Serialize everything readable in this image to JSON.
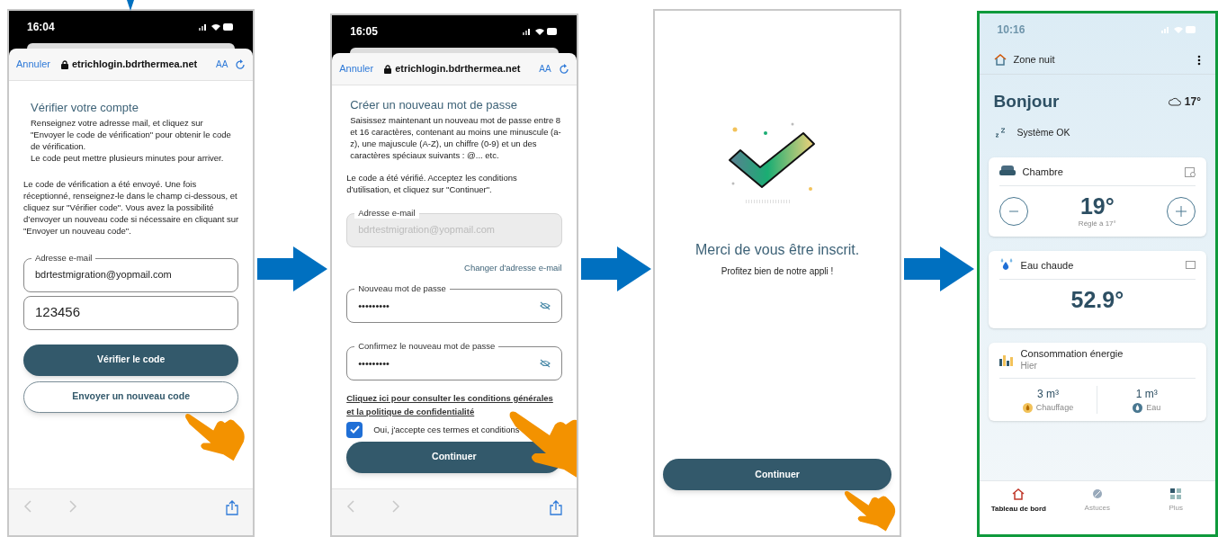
{
  "screens": [
    {
      "kind": "verify",
      "time": "16:04",
      "browser": {
        "cancel": "Annuler",
        "url": "etrichlogin.bdrthermea.net",
        "text_size": "AA"
      },
      "title": "Vérifier votre compte",
      "paragraphs": [
        "Renseignez votre adresse mail, et cliquez sur \"Envoyer le code de vérification\" pour obtenir le code de vérification.\nLe code peut mettre plusieurs minutes pour arriver.",
        "Le code de vérification a été envoyé. Une fois réceptionné, renseignez-le dans le champ ci-dessous, et cliquez sur \"Vérifier code\". Vous avez la possibilité d’envoyer un nouveau code si nécessaire en cliquant sur \"Envoyer un nouveau code\"."
      ],
      "email_field": {
        "label": "Adresse e-mail",
        "value": "bdrtestmigration@yopmail.com",
        "disabled": false
      },
      "code_field": {
        "value": "123456"
      },
      "buttons": [
        {
          "label": "Vérifier le code",
          "primary": true
        },
        {
          "label": "Envoyer un nouveau code",
          "primary": false
        }
      ]
    },
    {
      "kind": "password",
      "time": "16:05",
      "browser": {
        "cancel": "Annuler",
        "url": "etrichlogin.bdrthermea.net",
        "text_size": "AA"
      },
      "title": "Créer un nouveau mot de passe",
      "paragraphs": [
        "Saisissez maintenant un nouveau mot de passe entre 8 et 16 caractères, contenant au moins une minuscule (a-z), une majuscule (A-Z), un chiffre (0-9) et un des caractères spéciaux suivants : @... etc.",
        "Le code a été vérifié. Acceptez les conditions d’utilisation, et cliquez sur \"Continuer\"."
      ],
      "email_field": {
        "label": "Adresse e-mail",
        "value": "bdrtestmigration@yopmail.com",
        "disabled": true
      },
      "change_email_link": "Changer d'adresse e-mail",
      "password_fields": [
        {
          "label": "Nouveau mot de passe",
          "value": "•••••••••"
        },
        {
          "label": "Confirmez le nouveau mot de passe",
          "value": "•••••••••"
        }
      ],
      "terms_link": "Cliquez ici pour consulter les conditions générales et la politique de confidentialité",
      "consent": {
        "label": "Oui, j'accepte ces termes et conditions",
        "checked": true
      },
      "button": "Continuer"
    },
    {
      "kind": "success",
      "title": "Merci de vous être inscrit.",
      "subtitle": "Profitez bien de notre appli !",
      "button": "Continuer"
    },
    {
      "kind": "dashboard",
      "time": "10:16",
      "zone": "Zone nuit",
      "greeting": "Bonjour",
      "weather": "17°",
      "status": "Système OK",
      "room_card": {
        "name": "Chambre",
        "temperature": "19°",
        "setpoint": "Réglé à 17°"
      },
      "water_card": {
        "name": "Eau chaude",
        "temperature": "52.9°"
      },
      "energy_card": {
        "title": "Consommation énergie",
        "period": "Hier",
        "items": [
          {
            "kind": "heating",
            "value": "3 m³",
            "label": "Chauffage"
          },
          {
            "kind": "water",
            "value": "1 m³",
            "label": "Eau"
          }
        ]
      },
      "nav": [
        {
          "kind": "home",
          "label": "Tableau de bord",
          "selected": true
        },
        {
          "kind": "tips",
          "label": "Astuces",
          "selected": false
        },
        {
          "kind": "more",
          "label": "Plus",
          "selected": false
        }
      ]
    }
  ]
}
